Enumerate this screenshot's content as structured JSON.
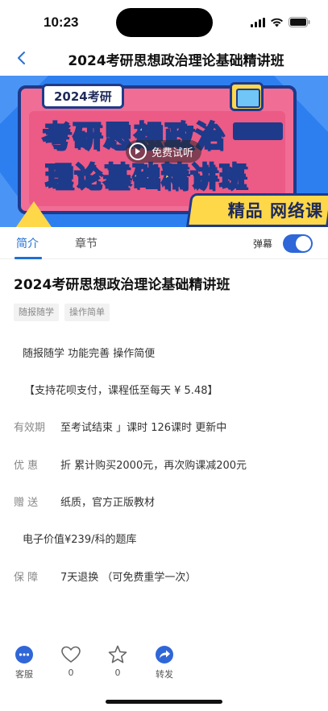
{
  "status_bar": {
    "time": "10:23"
  },
  "nav": {
    "title": "2024考研思想政治理论基础精讲班"
  },
  "banner": {
    "year_badge": "2024考研",
    "headline_line1": "考研思想政治",
    "headline_line2": "理论基础精讲班",
    "corner_badge": "精品 网络课",
    "free_preview_label": "免费试听"
  },
  "tabs": {
    "items": [
      {
        "label": "简介"
      },
      {
        "label": "章节"
      }
    ],
    "danmu_label": "弹幕",
    "danmu_on": true
  },
  "course": {
    "title": "2024考研思想政治理论基础精讲班",
    "tags": [
      "随报随学",
      "操作简单"
    ],
    "features": "随报随学 功能完善 操作简便",
    "payment_note": "【支持花呗支付，课程低至每天 ¥ 5.48】",
    "validity_label": "有效期",
    "validity_value": "至考试结束 」课时 126课时 更新中",
    "discount_label": "优 惠",
    "discount_value": "折 累计购买2000元，再次购课减200元",
    "gift_label": "赠 送",
    "gift_value": "纸质，官方正版教材",
    "question_bank": "电子价值¥239/科的题库",
    "guarantee_label": "保 障",
    "guarantee_value": "7天退换 （可免费重学一次）"
  },
  "bottom_bar": {
    "service_label": "客服",
    "like_count": "0",
    "favorite_count": "0",
    "share_label": "转发"
  },
  "colors": {
    "accent": "#1f6fd6",
    "toggle": "#2f66d8",
    "banner_pink": "#f06d96",
    "banner_blue": "#2d7ff0",
    "banner_yellow": "#ffd84a"
  }
}
